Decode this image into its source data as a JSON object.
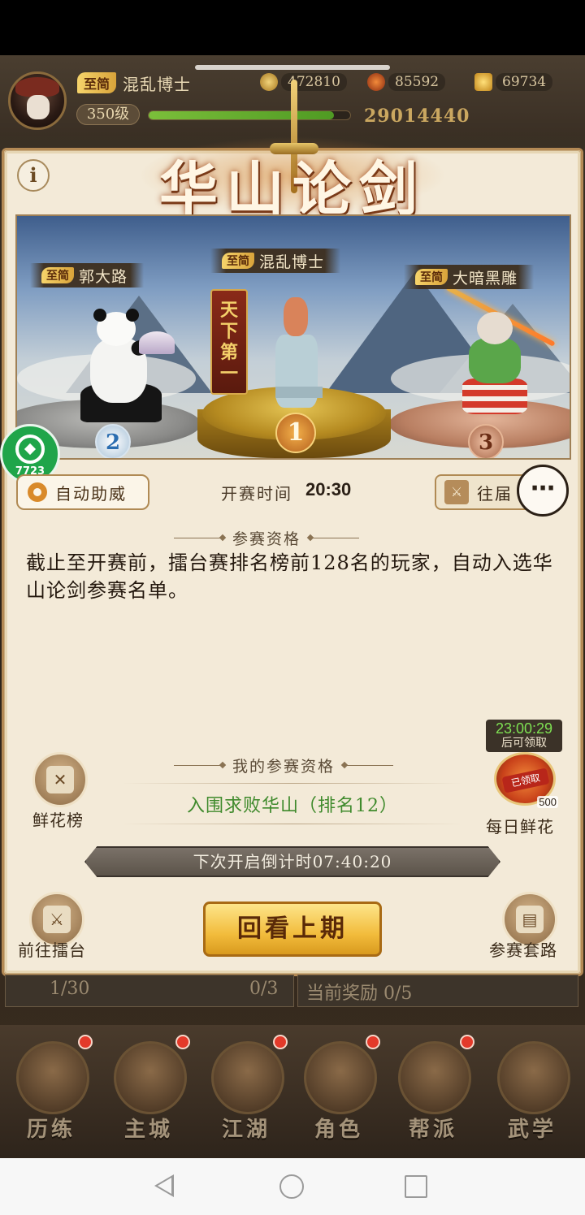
{
  "header": {
    "vip_tag": "至简",
    "player_name": "混乱博士",
    "level": "350级",
    "copper": "472810",
    "stamina": "85592",
    "gold": "69734",
    "exp_progress": 0.92,
    "combat_power": "29014440"
  },
  "panel": {
    "title": "华山论剑",
    "info_glyph": "i",
    "podium": {
      "first": {
        "vip": "至简",
        "name": "混乱博士",
        "rank": "1"
      },
      "second": {
        "vip": "至简",
        "name": "郭大路",
        "rank": "2"
      },
      "third": {
        "vip": "至简",
        "name": "大暗黑雕",
        "rank": "3"
      },
      "flag_chars": [
        "天",
        "下",
        "第",
        "一"
      ]
    },
    "auto_cheer_label": "自动助威",
    "start_time_label": "开赛时间",
    "start_time": "20:30",
    "past_label": "往届",
    "qualification_header": "参赛资格",
    "qualification_desc": "截止至开赛前，擂台赛排名榜前128名的玩家，自动入选华山论剑参赛名单。",
    "my_qualification_header": "我的参赛资格",
    "my_qualification_value": "入围求败华山（排名12）",
    "flower_rank_label": "鲜花榜",
    "daily_flower_label": "每日鲜花",
    "daily_flower_timer": "23:00:29",
    "daily_flower_timer_note": "后可领取",
    "daily_flower_claimed": "已领取",
    "daily_flower_count": "500",
    "countdown": "下次开启倒计时07:40:20",
    "review_button": "回看上期",
    "go_arena_label": "前往擂台",
    "routine_label": "参赛套路"
  },
  "float_badge": {
    "label": "7723"
  },
  "under_strip": {
    "left_text": "1/30",
    "left_mid": "0/3",
    "right_text": "当前奖励 0/5"
  },
  "nav": {
    "items": [
      "历练",
      "主城",
      "江湖",
      "角色",
      "帮派",
      "武学"
    ]
  },
  "icons": {
    "chat": "chat-bubble-icon",
    "cog": "gear-icon",
    "crossed_swords": "crossed-swords-icon",
    "book": "book-icon"
  }
}
